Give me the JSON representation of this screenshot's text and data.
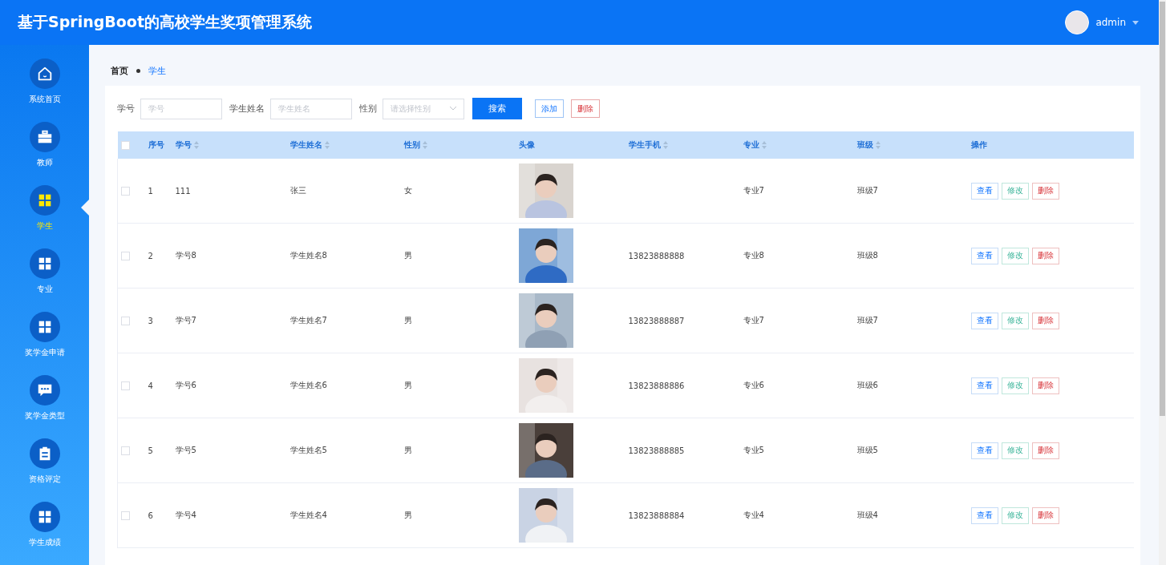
{
  "header": {
    "title": "基于SpringBoot的高校学生奖项管理系统",
    "user": "admin"
  },
  "sidebar": {
    "items": [
      {
        "label": "系统首页",
        "kind": "home",
        "selected": false
      },
      {
        "label": "教师",
        "kind": "briefcase",
        "selected": false
      },
      {
        "label": "学生",
        "kind": "grid",
        "selected": true
      },
      {
        "label": "专业",
        "kind": "grid",
        "selected": false
      },
      {
        "label": "奖学金申请",
        "kind": "grid",
        "selected": false
      },
      {
        "label": "奖学金类型",
        "kind": "chat",
        "selected": false
      },
      {
        "label": "资格评定",
        "kind": "clipboard",
        "selected": false
      },
      {
        "label": "学生成绩",
        "kind": "grid",
        "selected": false
      }
    ]
  },
  "breadcrumb": [
    "首页",
    "学生"
  ],
  "search": {
    "fields": [
      {
        "label": "学号",
        "placeholder": "学号",
        "kind": "input"
      },
      {
        "label": "学生姓名",
        "placeholder": "学生姓名",
        "kind": "input"
      },
      {
        "label": "性别",
        "placeholder": "请选择性别",
        "kind": "select"
      }
    ],
    "search_button": "搜索",
    "add_button": "添加",
    "delete_button": "删除"
  },
  "table": {
    "all_checked": false,
    "columns": [
      {
        "label": "序号",
        "sortable": false
      },
      {
        "label": "学号",
        "sortable": true
      },
      {
        "label": "学生姓名",
        "sortable": true
      },
      {
        "label": "性别",
        "sortable": true
      },
      {
        "label": "头像",
        "sortable": false
      },
      {
        "label": "学生手机",
        "sortable": true
      },
      {
        "label": "专业",
        "sortable": true
      },
      {
        "label": "班级",
        "sortable": true
      },
      {
        "label": "操作",
        "sortable": false
      }
    ],
    "rows": [
      {
        "selected": false,
        "index": "1",
        "student_id": "111",
        "name": "张三",
        "gender": "女",
        "major": "专业7",
        "class": "班级7",
        "actions": [
          {
            "label": "查看",
            "kind": "view"
          },
          {
            "label": "修改",
            "kind": "edit"
          },
          {
            "label": "删除",
            "kind": "delete"
          }
        ]
      },
      {
        "selected": false,
        "index": "2",
        "student_id": "学号8",
        "name": "学生姓名8",
        "gender": "男",
        "phone": "13823888888",
        "major": "专业8",
        "class": "班级8",
        "actions": [
          {
            "label": "查看",
            "kind": "view"
          },
          {
            "label": "修改",
            "kind": "edit"
          },
          {
            "label": "删除",
            "kind": "delete"
          }
        ]
      },
      {
        "selected": false,
        "index": "3",
        "student_id": "学号7",
        "name": "学生姓名7",
        "gender": "男",
        "phone": "13823888887",
        "major": "专业7",
        "class": "班级7",
        "actions": [
          {
            "label": "查看",
            "kind": "view"
          },
          {
            "label": "修改",
            "kind": "edit"
          },
          {
            "label": "删除",
            "kind": "delete"
          }
        ]
      },
      {
        "selected": false,
        "index": "4",
        "student_id": "学号6",
        "name": "学生姓名6",
        "gender": "男",
        "phone": "13823888886",
        "major": "专业6",
        "class": "班级6",
        "actions": [
          {
            "label": "查看",
            "kind": "view"
          },
          {
            "label": "修改",
            "kind": "edit"
          },
          {
            "label": "删除",
            "kind": "delete"
          }
        ]
      },
      {
        "selected": false,
        "index": "5",
        "student_id": "学号5",
        "name": "学生姓名5",
        "gender": "男",
        "phone": "13823888885",
        "major": "专业5",
        "class": "班级5",
        "actions": [
          {
            "label": "查看",
            "kind": "view"
          },
          {
            "label": "修改",
            "kind": "edit"
          },
          {
            "label": "删除",
            "kind": "delete"
          }
        ]
      },
      {
        "selected": false,
        "index": "6",
        "student_id": "学号4",
        "name": "学生姓名4",
        "gender": "男",
        "phone": "13823888884",
        "major": "专业4",
        "class": "班级4",
        "actions": [
          {
            "label": "查看",
            "kind": "view"
          },
          {
            "label": "修改",
            "kind": "edit"
          },
          {
            "label": "删除",
            "kind": "delete"
          }
        ]
      }
    ]
  }
}
